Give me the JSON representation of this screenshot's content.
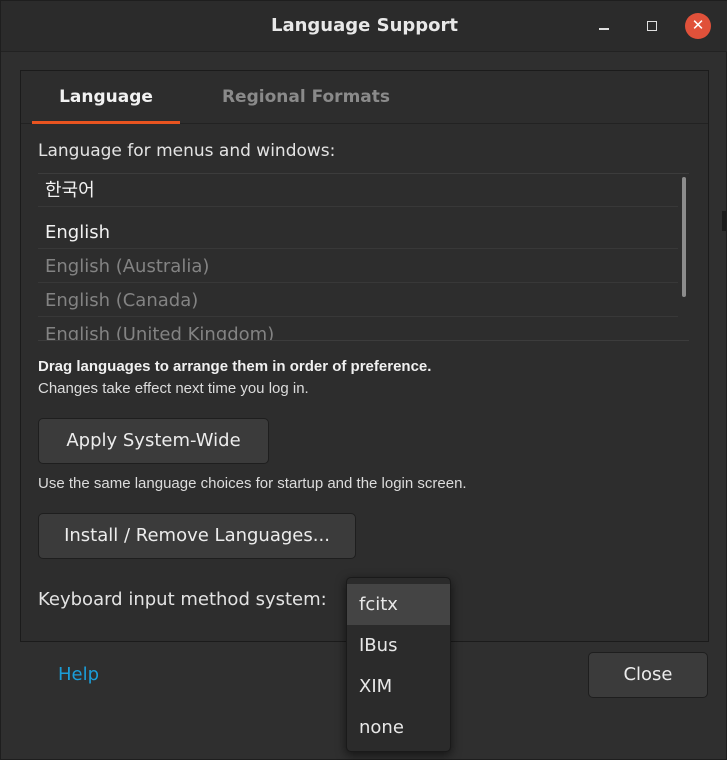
{
  "window": {
    "title": "Language Support"
  },
  "titlebar_icons": {
    "minimize": "minimize-icon",
    "maximize": "maximize-icon",
    "close": "close-icon",
    "close_color": "#e0513a"
  },
  "tabs": [
    {
      "label": "Language",
      "active": true
    },
    {
      "label": "Regional Formats",
      "active": false
    }
  ],
  "language_section": {
    "label": "Language for menus and windows:",
    "languages": [
      {
        "name": "한국어",
        "enabled": true
      },
      {
        "name": "English",
        "enabled": true
      },
      {
        "name": "English (Australia)",
        "enabled": false
      },
      {
        "name": "English (Canada)",
        "enabled": false
      },
      {
        "name": "English (United Kingdom)",
        "enabled": false
      }
    ],
    "hint_bold": "Drag languages to arrange them in order of preference.",
    "hint": "Changes take effect next time you log in."
  },
  "buttons": {
    "apply_system_wide": "Apply System-Wide",
    "apply_description": "Use the same language choices for startup and the login screen.",
    "install_remove": "Install / Remove Languages...",
    "close": "Close"
  },
  "keyboard": {
    "label": "Keyboard input method system:",
    "selected": "fcitx",
    "options": [
      "fcitx",
      "IBus",
      "XIM",
      "none"
    ]
  },
  "footer": {
    "help": "Help"
  },
  "colors": {
    "accent": "#e95420",
    "link": "#1b9ed9"
  }
}
